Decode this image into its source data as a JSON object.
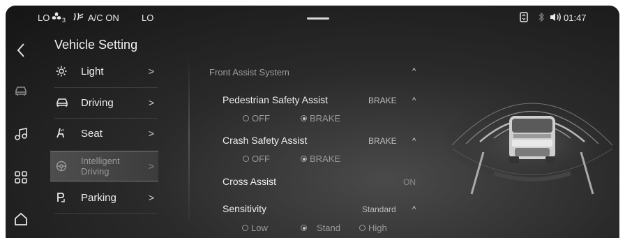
{
  "status": {
    "left_temp": "LO",
    "fan_level": "3",
    "ac_label": "A/C ON",
    "right_temp": "LO",
    "time": "01:47",
    "icons": [
      "fan-icon",
      "defrost-icon",
      "phone-link-icon",
      "bluetooth-icon",
      "volume-icon"
    ]
  },
  "rail": {
    "items": [
      "back-arrow-icon",
      "car-icon",
      "music-icon",
      "apps-grid-icon",
      "home-icon"
    ]
  },
  "menu": {
    "title": "Vehicle Setting",
    "items": [
      {
        "label": "Light",
        "icon": "sun-icon"
      },
      {
        "label": "Driving",
        "icon": "car-outline-icon"
      },
      {
        "label": "Seat",
        "icon": "seat-icon"
      },
      {
        "label": "Intelligent Driving",
        "label_line1": "Intelligent",
        "label_line2": "Driving",
        "icon": "steering-wheel-icon",
        "selected": true
      },
      {
        "label": "Parking",
        "icon": "parking-icon"
      }
    ],
    "arrow": ">"
  },
  "panel": {
    "section_title": "Front Assist System",
    "rows": [
      {
        "label": "Pedestrian Safety Assist",
        "value": "BRAKE",
        "options": [
          "OFF",
          "BRAKE"
        ],
        "selected": "BRAKE"
      },
      {
        "label": "Crash Safety Assist",
        "value": "BRAKE",
        "options": [
          "OFF",
          "BRAKE"
        ],
        "selected": "BRAKE"
      },
      {
        "label": "Cross Assist",
        "value": "ON"
      },
      {
        "label": "Sensitivity",
        "value": "Standard",
        "options": [
          "Low",
          "Stand",
          "High"
        ],
        "selected": "Stand"
      }
    ],
    "chevron": "^"
  },
  "colors": {
    "background": "#1c1c1c",
    "text": "#f0f0f0",
    "muted": "#9a9a9a"
  }
}
